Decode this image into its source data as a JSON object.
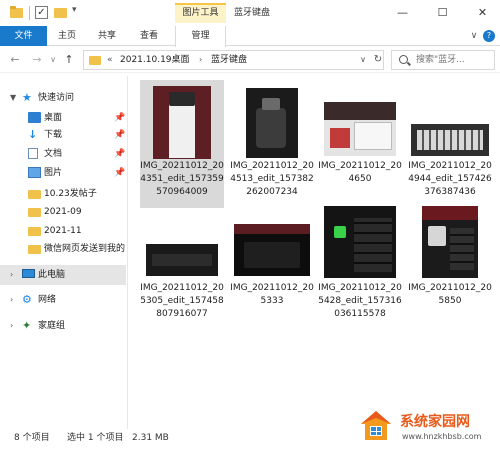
{
  "window": {
    "context_tab": "图片工具",
    "title": "蓝牙键盘",
    "min": "—",
    "max": "☐",
    "close": "✕"
  },
  "ribbon": {
    "tabs": [
      "文件",
      "主页",
      "共享",
      "查看",
      "管理"
    ],
    "toggle": "∨",
    "help": "?"
  },
  "address": {
    "overflow": "«",
    "crumbs": [
      "2021.10.19桌面",
      "蓝牙键盘"
    ],
    "separator": "›",
    "search_placeholder": "搜索\"蓝牙..."
  },
  "sidebar": {
    "items": [
      {
        "label": "快速访问",
        "icon": "star-icon"
      },
      {
        "label": "桌面",
        "icon": "desktop-icon",
        "pinned": true
      },
      {
        "label": "下载",
        "icon": "download-icon",
        "pinned": true
      },
      {
        "label": "文档",
        "icon": "document-icon",
        "pinned": true
      },
      {
        "label": "图片",
        "icon": "pictures-icon",
        "pinned": true
      },
      {
        "label": "10.23发帖子",
        "icon": "folder-icon"
      },
      {
        "label": "2021-09",
        "icon": "folder-icon"
      },
      {
        "label": "2021-11",
        "icon": "folder-icon"
      },
      {
        "label": "微信网页发送到我的",
        "icon": "folder-icon"
      },
      {
        "label": "此电脑",
        "icon": "computer-icon"
      },
      {
        "label": "网络",
        "icon": "network-icon"
      },
      {
        "label": "家庭组",
        "icon": "homegroup-icon"
      }
    ]
  },
  "files": [
    {
      "name": "IMG_20211012_204351_edit_157359570964009",
      "selected": true
    },
    {
      "name": "IMG_20211012_204513_edit_157382262007234"
    },
    {
      "name": "IMG_20211012_204650"
    },
    {
      "name": "IMG_20211012_204944_edit_157426376387436"
    },
    {
      "name": "IMG_20211012_205305_edit_157458807916077"
    },
    {
      "name": "IMG_20211012_205333"
    },
    {
      "name": "IMG_20211012_205428_edit_157316036115578"
    },
    {
      "name": "IMG_20211012_205850"
    }
  ],
  "status": {
    "count": "8 个项目",
    "selected": "选中 1 个项目",
    "size": "2.31 MB"
  },
  "watermark": {
    "title": "系统家园网",
    "url": "www.hnzkhbsb.com"
  },
  "colors": {
    "accent": "#1979ca",
    "selection": "#d9d9d9",
    "folder": "#f1c24b",
    "context_tab": "#fdf3c8"
  }
}
